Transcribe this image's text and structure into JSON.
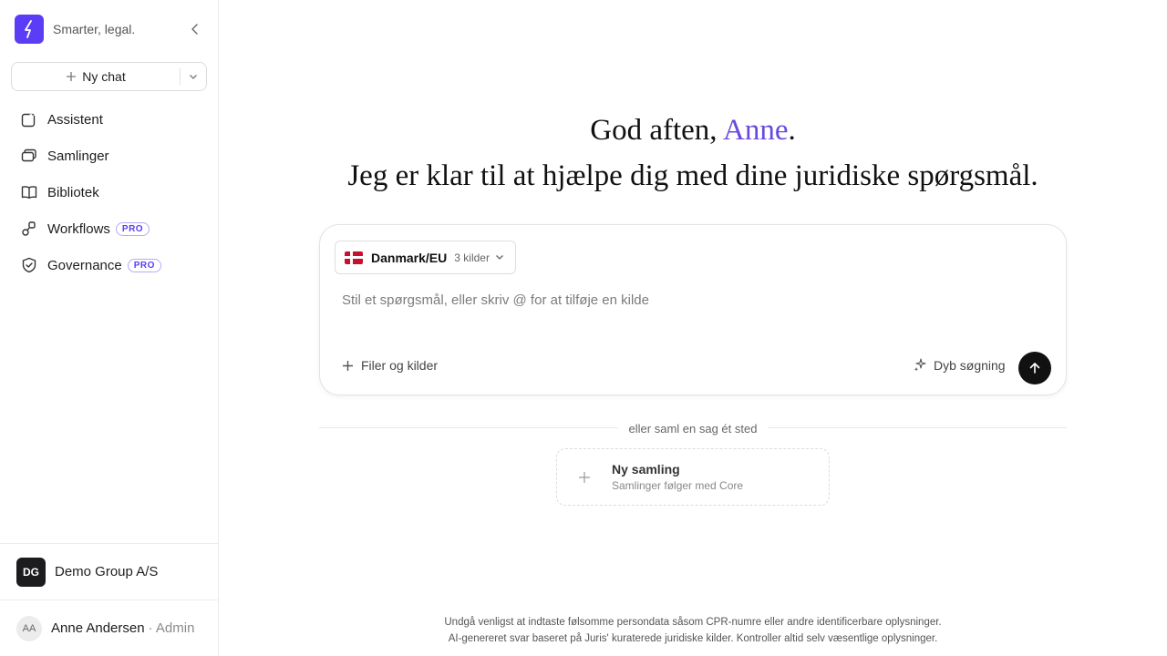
{
  "brand": {
    "tagline": "Smarter, legal.",
    "accent": "#5b3df5"
  },
  "sidebar": {
    "new_chat": "Ny chat",
    "items": [
      {
        "label": "Assistent",
        "icon": "assistant-icon",
        "badge": ""
      },
      {
        "label": "Samlinger",
        "icon": "collections-icon",
        "badge": ""
      },
      {
        "label": "Bibliotek",
        "icon": "book-icon",
        "badge": ""
      },
      {
        "label": "Workflows",
        "icon": "workflow-icon",
        "badge": "PRO"
      },
      {
        "label": "Governance",
        "icon": "shield-icon",
        "badge": "PRO"
      }
    ],
    "org": {
      "initials": "DG",
      "name": "Demo Group A/S"
    },
    "user": {
      "initials": "AA",
      "name": "Anne Andersen",
      "role": "· Admin"
    }
  },
  "main": {
    "greeting_prefix": "God aften, ",
    "greeting_name": "Anne",
    "greeting_suffix": ".",
    "greeting_line2": "Jeg er klar til at hjælpe dig med dine juridiske spørgsmål.",
    "composer": {
      "jurisdiction": "Danmark/EU",
      "source_count": "3 kilder",
      "placeholder": "Stil et spørgsmål, eller skriv @ for at tilføje en kilde",
      "files_label": "Filer og kilder",
      "deep_label": "Dyb søgning"
    },
    "divider": "eller saml en sag ét sted",
    "new_collection": {
      "title": "Ny samling",
      "subtitle": "Samlinger følger med Core"
    },
    "disclaimer_line1": "Undgå venligst at indtaste følsomme persondata såsom CPR-numre eller andre identificerbare oplysninger.",
    "disclaimer_line2": "AI-genereret svar baseret på Juris' kuraterede juridiske kilder. Kontroller altid selv væsentlige oplysninger."
  }
}
